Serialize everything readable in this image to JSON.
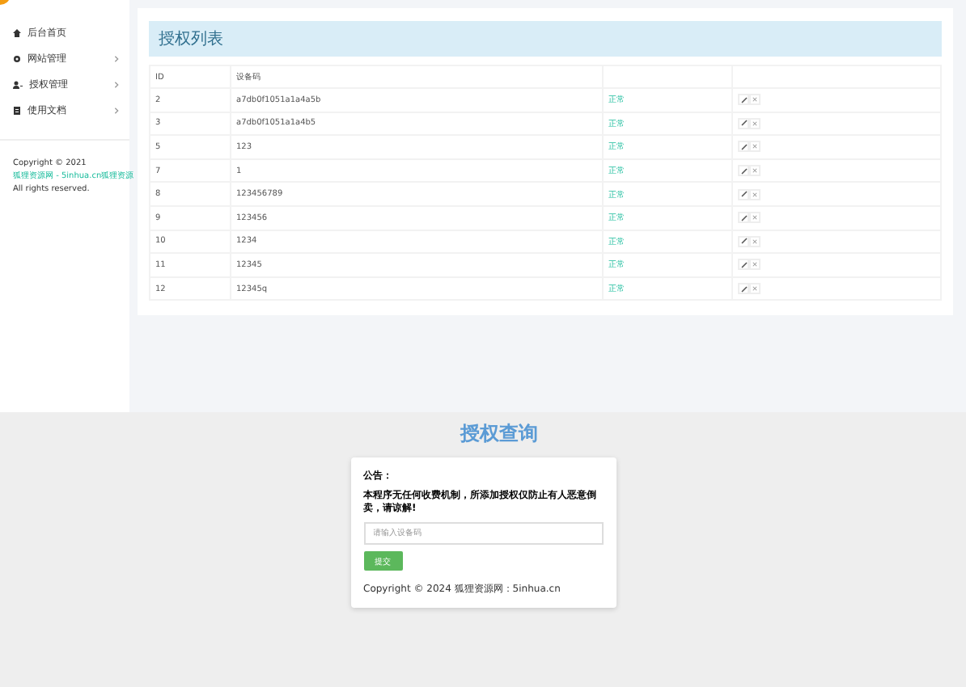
{
  "sidebar": {
    "items": [
      {
        "label": "后台首页",
        "kind": "home",
        "expandable": false
      },
      {
        "label": "网站管理",
        "kind": "gear",
        "expandable": true
      },
      {
        "label": "授权管理",
        "kind": "users",
        "expandable": true
      },
      {
        "label": "使用文档",
        "kind": "doc",
        "expandable": true
      }
    ],
    "copyright": {
      "prefix": "Copyright © 2021 ",
      "link": "狐狸资源网 - 5inhua.cn狐狸资源",
      "suffix": " All rights reserved."
    }
  },
  "panel": {
    "title": "授权列表",
    "columns": [
      "ID",
      "设备码"
    ],
    "rows": [
      {
        "id": "2",
        "code": "a7db0f1051a1a4a5b",
        "status": "正常"
      },
      {
        "id": "3",
        "code": "a7db0f1051a1a4b5",
        "status": "正常"
      },
      {
        "id": "5",
        "code": "123",
        "status": "正常"
      },
      {
        "id": "7",
        "code": "1",
        "status": "正常"
      },
      {
        "id": "8",
        "code": "123456789",
        "status": "正常"
      },
      {
        "id": "9",
        "code": "123456",
        "status": "正常"
      },
      {
        "id": "10",
        "code": "1234",
        "status": "正常"
      },
      {
        "id": "11",
        "code": "12345",
        "status": "正常"
      },
      {
        "id": "12",
        "code": "12345q",
        "status": "正常"
      }
    ]
  },
  "query": {
    "logo": "授权查询",
    "notice_title": "公告：",
    "notice": "本程序无任何收费机制，所添加授权仅防止有人恶意倒卖，请谅解!",
    "placeholder": "请输入设备码",
    "button": "提交",
    "footer": "Copyright © 2024 狐狸资源网：5inhua.cn"
  }
}
